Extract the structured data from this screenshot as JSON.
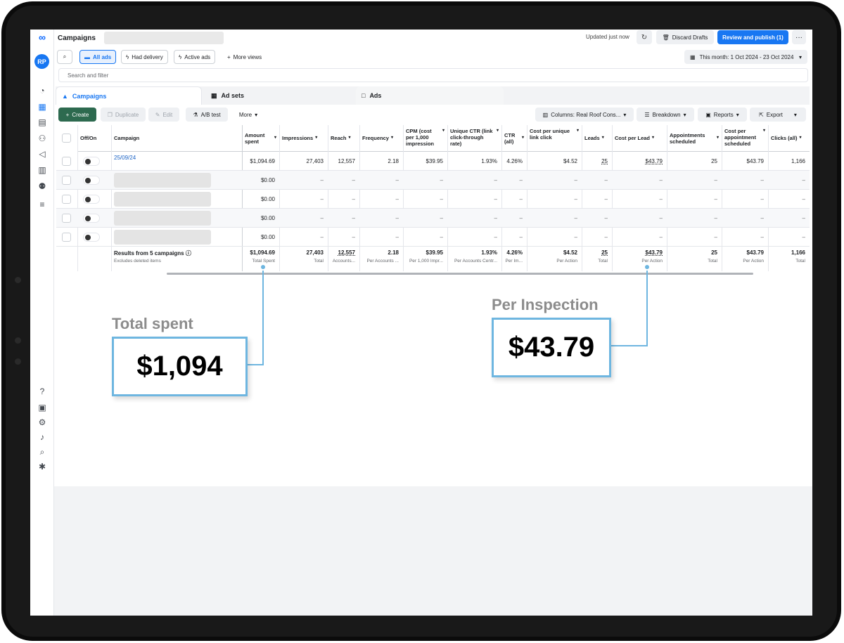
{
  "header": {
    "title": "Campaigns",
    "updated_text": "Updated just now",
    "discard_label": "Discard Drafts",
    "publish_label": "Review and publish (1)",
    "more_glyph": "···"
  },
  "filters": {
    "chips": [
      "All ads",
      "Had delivery",
      "Active ads",
      "More views"
    ],
    "date_range": "This month: 1 Oct 2024 - 23 Oct 2024",
    "search_placeholder": "Search and filter"
  },
  "tabs": [
    "Campaigns",
    "Ad sets",
    "Ads"
  ],
  "toolbar": {
    "create": "Create",
    "duplicate": "Duplicate",
    "edit": "Edit",
    "ab_test": "A/B test",
    "more": "More",
    "columns": "Columns: Real Roof Cons...",
    "breakdown": "Breakdown",
    "reports": "Reports",
    "export": "Export"
  },
  "table": {
    "headers": {
      "onoff": "Off/On",
      "campaign": "Campaign",
      "amount_spent": "Amount spent",
      "impressions": "Impressions",
      "reach": "Reach",
      "frequency": "Frequency",
      "cpm": "CPM (cost per 1,000 impression",
      "unique_ctr": "Unique CTR (link click-through rate)",
      "ctr": "CTR (all)",
      "cost_unique_click": "Cost per unique link click",
      "leads": "Leads",
      "cost_per_lead": "Cost per Lead",
      "appointments": "Appointments scheduled",
      "cost_per_appt": "Cost per appointment scheduled",
      "clicks": "Clicks (all)"
    },
    "first_row": {
      "campaign": "25/09/24",
      "amount_spent": "$1,094.69",
      "impressions": "27,403",
      "reach": "12,557",
      "frequency": "2.18",
      "cpm": "$39.95",
      "unique_ctr": "1.93%",
      "ctr": "4.26%",
      "cost_unique_click": "$4.52",
      "leads": "25",
      "cost_per_lead": "$43.79",
      "appointments": "25",
      "cost_per_appt": "$43.79",
      "clicks": "1,166"
    },
    "empty_amount": "$0.00",
    "dash": "–",
    "totals": {
      "label": "Results from 5 campaigns",
      "sublabel": "Excludes deleted items",
      "amount_spent": "$1,094.69",
      "amount_spent_sub": "Total Spent",
      "impressions": "27,403",
      "impressions_sub": "Total",
      "reach": "12,557",
      "reach_sub": "Accounts...",
      "frequency": "2.18",
      "frequency_sub": "Per Accounts ...",
      "cpm": "$39.95",
      "cpm_sub": "Per 1,000 Impr...",
      "unique_ctr": "1.93%",
      "unique_ctr_sub": "Per Accounts Centr...",
      "ctr": "4.26%",
      "ctr_sub": "Per Im...",
      "cost_unique_click": "$4.52",
      "cost_unique_click_sub": "Per Action",
      "leads": "25",
      "leads_sub": "Total",
      "cost_per_lead": "$43.79",
      "cost_per_lead_sub": "Per Action",
      "appointments": "25",
      "appointments_sub": "Total",
      "cost_per_appt": "$43.79",
      "cost_per_appt_sub": "Per Action",
      "clicks": "1,166",
      "clicks_sub": "Total"
    }
  },
  "callouts": {
    "total_label": "Total spent",
    "total_value": "$1,094",
    "inspection_label": "Per Inspection",
    "inspection_value": "$43.79",
    "accent": "#6eb6e0"
  },
  "colors": {
    "primary": "#1877f2",
    "create_button": "#2d6a4f"
  }
}
